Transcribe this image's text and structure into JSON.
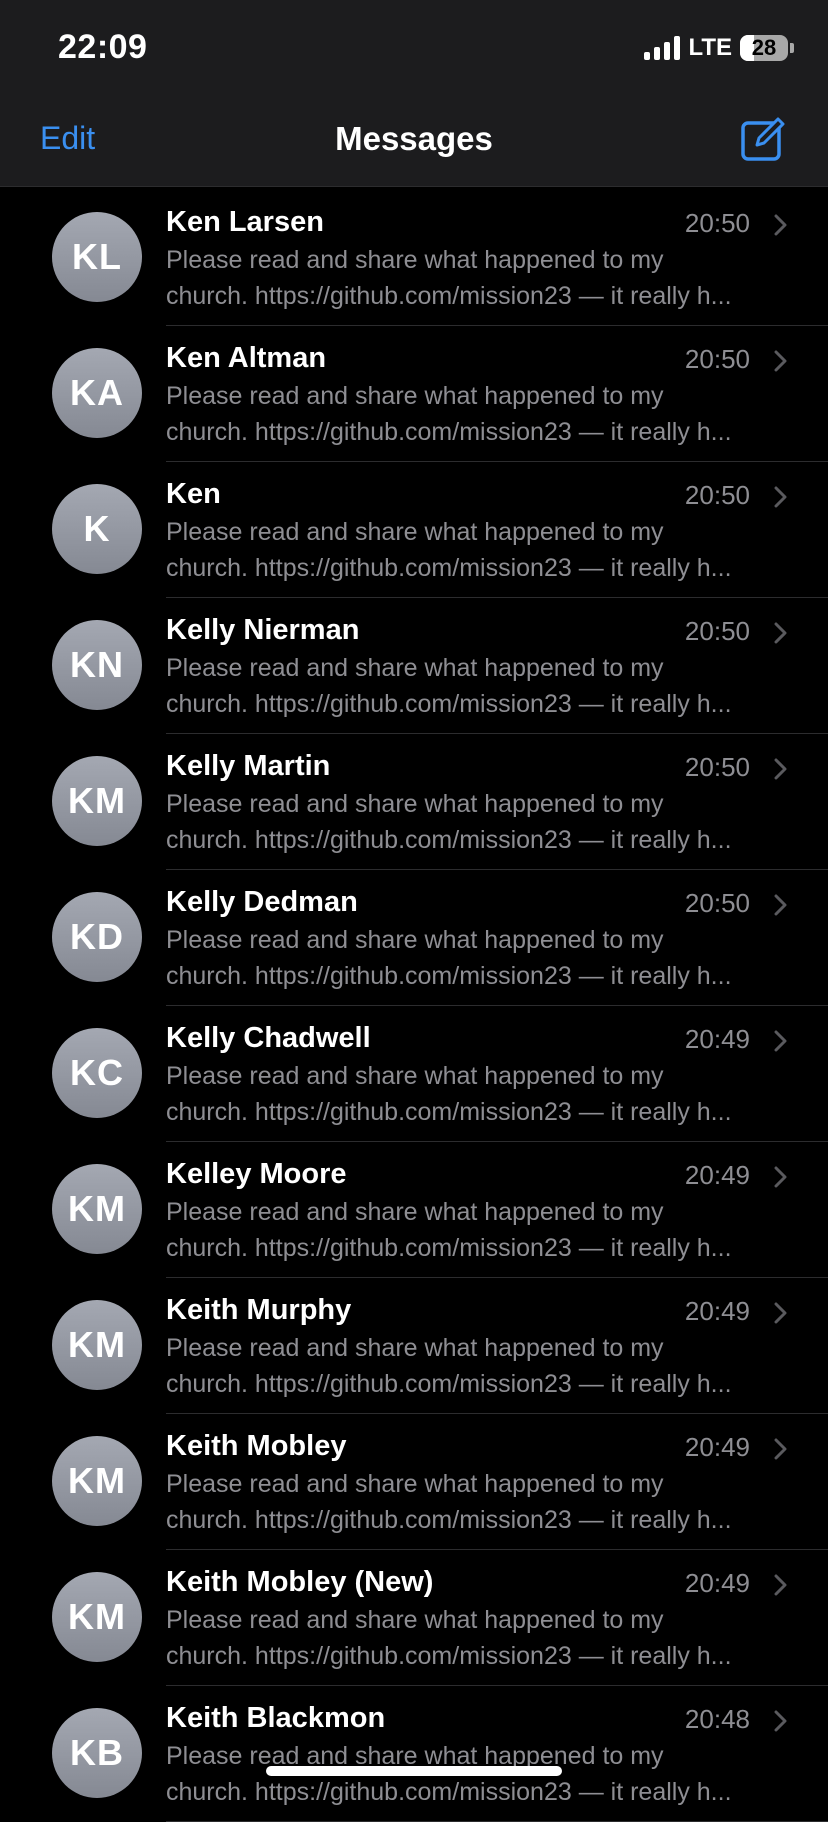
{
  "status_bar": {
    "time": "22:09",
    "network": "LTE",
    "battery": "28"
  },
  "nav": {
    "edit_label": "Edit",
    "title": "Messages",
    "compose_icon": "compose-icon"
  },
  "colors": {
    "accent": "#3a8ff0",
    "background": "#000000",
    "secondary_text": "#8e8e93"
  },
  "messages": [
    {
      "initials": "KL",
      "name": "Ken Larsen",
      "time": "20:50",
      "preview_line1": "Please read and share what happened to my",
      "preview_line2": "church. https://github.com/mission23 — it really h..."
    },
    {
      "initials": "KA",
      "name": "Ken Altman",
      "time": "20:50",
      "preview_line1": "Please read and share what happened to my",
      "preview_line2": "church. https://github.com/mission23 — it really h..."
    },
    {
      "initials": "K",
      "name": "Ken",
      "time": "20:50",
      "preview_line1": "Please read and share what happened to my",
      "preview_line2": "church. https://github.com/mission23 — it really h..."
    },
    {
      "initials": "KN",
      "name": "Kelly Nierman",
      "time": "20:50",
      "preview_line1": "Please read and share what happened to my",
      "preview_line2": "church. https://github.com/mission23 — it really h..."
    },
    {
      "initials": "KM",
      "name": "Kelly Martin",
      "time": "20:50",
      "preview_line1": "Please read and share what happened to my",
      "preview_line2": "church. https://github.com/mission23 — it really h..."
    },
    {
      "initials": "KD",
      "name": "Kelly Dedman",
      "time": "20:50",
      "preview_line1": "Please read and share what happened to my",
      "preview_line2": "church. https://github.com/mission23 — it really h..."
    },
    {
      "initials": "KC",
      "name": "Kelly Chadwell",
      "time": "20:49",
      "preview_line1": "Please read and share what happened to my",
      "preview_line2": "church. https://github.com/mission23 — it really h..."
    },
    {
      "initials": "KM",
      "name": "Kelley Moore",
      "time": "20:49",
      "preview_line1": "Please read and share what happened to my",
      "preview_line2": "church. https://github.com/mission23 — it really h..."
    },
    {
      "initials": "KM",
      "name": "Keith Murphy",
      "time": "20:49",
      "preview_line1": "Please read and share what happened to my",
      "preview_line2": "church. https://github.com/mission23 — it really h..."
    },
    {
      "initials": "KM",
      "name": "Keith Mobley",
      "time": "20:49",
      "preview_line1": "Please read and share what happened to my",
      "preview_line2": "church. https://github.com/mission23 — it really h..."
    },
    {
      "initials": "KM",
      "name": "Keith Mobley (New)",
      "time": "20:49",
      "preview_line1": "Please read and share what happened to my",
      "preview_line2": "church. https://github.com/mission23 — it really h..."
    },
    {
      "initials": "KB",
      "name": "Keith Blackmon",
      "time": "20:48",
      "preview_line1": "Please read and share what happened to my",
      "preview_line2": "church. https://github.com/mission23 — it really h..."
    }
  ]
}
